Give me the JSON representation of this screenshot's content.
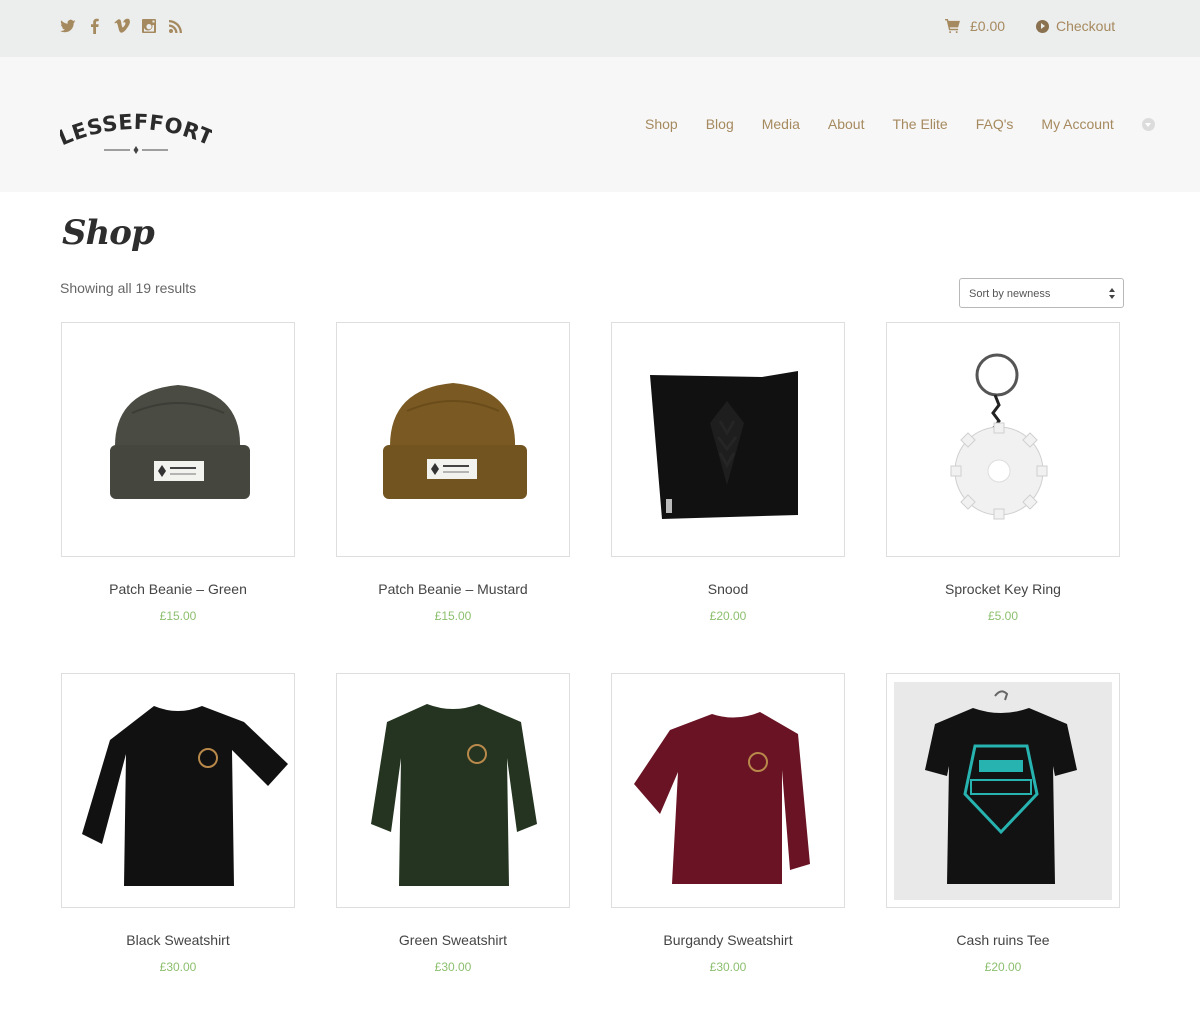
{
  "topbar": {
    "social": [
      {
        "icon": "twitter-icon"
      },
      {
        "icon": "facebook-icon"
      },
      {
        "icon": "vimeo-icon"
      },
      {
        "icon": "instagram-icon"
      },
      {
        "icon": "rss-icon"
      }
    ],
    "cart_total": "£0.00",
    "checkout_label": "Checkout"
  },
  "header": {
    "logo_text": "LESSEFFORT",
    "nav": [
      "Shop",
      "Blog",
      "Media",
      "About",
      "The Elite",
      "FAQ's",
      "My Account"
    ]
  },
  "main": {
    "title": "Shop",
    "results_text": "Showing all 19 results",
    "sort_selected": "Sort by newness"
  },
  "products": [
    {
      "name": "Patch Beanie – Green",
      "price": "£15.00"
    },
    {
      "name": "Patch Beanie – Mustard",
      "price": "£15.00"
    },
    {
      "name": "Snood",
      "price": "£20.00"
    },
    {
      "name": "Sprocket Key Ring",
      "price": "£5.00"
    },
    {
      "name": "Black Sweatshirt",
      "price": "£30.00"
    },
    {
      "name": "Green Sweatshirt",
      "price": "£30.00"
    },
    {
      "name": "Burgandy Sweatshirt",
      "price": "£30.00"
    },
    {
      "name": "Cash ruins Tee",
      "price": "£20.00"
    }
  ],
  "colors": {
    "accent": "#a68a5f",
    "price": "#8cbf6e",
    "topbar_bg": "#eceded",
    "header_bg": "#f7f7f7"
  }
}
